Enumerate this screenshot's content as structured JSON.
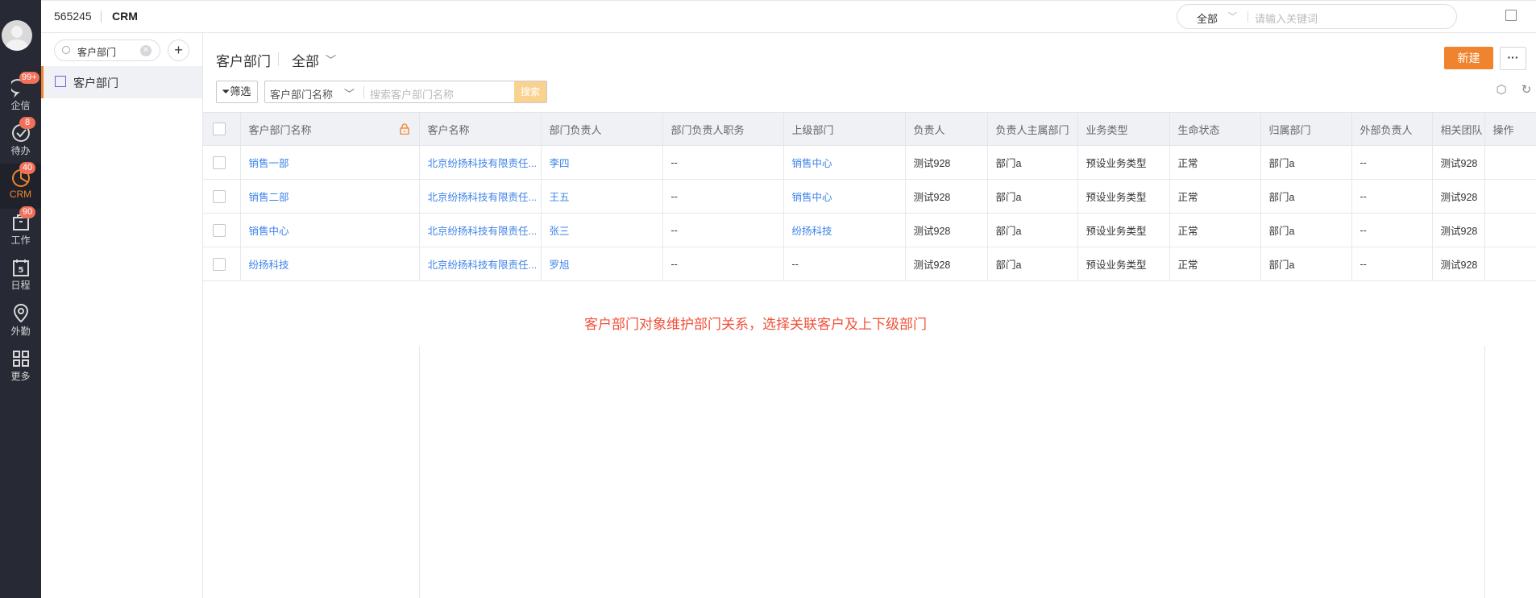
{
  "nav": {
    "items": [
      {
        "label": "企信",
        "badge": "99+",
        "icon": "chat-bubble-icon"
      },
      {
        "label": "待办",
        "badge": "8",
        "icon": "check-circle-icon"
      },
      {
        "label": "CRM",
        "badge": "40",
        "icon": "pie-chart-icon",
        "active": true
      },
      {
        "label": "工作",
        "badge": "90",
        "icon": "briefcase-icon"
      },
      {
        "label": "日程",
        "badge": null,
        "icon": "calendar-icon",
        "icon_text": "5"
      },
      {
        "label": "外勤",
        "badge": null,
        "icon": "location-pin-icon"
      },
      {
        "label": "更多",
        "badge": null,
        "icon": "grid-icon"
      }
    ]
  },
  "topbar": {
    "tenant_id": "565245",
    "app_name": "CRM",
    "search_scope": "全部",
    "search_placeholder": "请输入关键词"
  },
  "sidebar": {
    "search_value": "客户部门",
    "items": [
      {
        "label": "客户部门"
      }
    ]
  },
  "main": {
    "title": "客户部门",
    "scope": "全部",
    "new_label": "新建",
    "more_label": "···",
    "filter_label": "筛选",
    "search_field": "客户部门名称",
    "search_placeholder": "搜索客户部门名称",
    "search_button": "搜索"
  },
  "table": {
    "columns": [
      "客户部门名称",
      "客户名称",
      "部门负责人",
      "部门负责人职务",
      "上级部门",
      "负责人",
      "负责人主属部门",
      "业务类型",
      "生命状态",
      "归属部门",
      "外部负责人",
      "相关团队",
      "操作"
    ],
    "rows": [
      [
        "销售一部",
        "北京纷扬科技有限责任...",
        "李四",
        "--",
        "销售中心",
        "测试928",
        "部门a",
        "预设业务类型",
        "正常",
        "部门a",
        "--",
        "测试928",
        ""
      ],
      [
        "销售二部",
        "北京纷扬科技有限责任...",
        "王五",
        "--",
        "销售中心",
        "测试928",
        "部门a",
        "预设业务类型",
        "正常",
        "部门a",
        "--",
        "测试928",
        ""
      ],
      [
        "销售中心",
        "北京纷扬科技有限责任...",
        "张三",
        "--",
        "纷扬科技",
        "测试928",
        "部门a",
        "预设业务类型",
        "正常",
        "部门a",
        "--",
        "测试928",
        ""
      ],
      [
        "纷扬科技",
        "北京纷扬科技有限责任...",
        "罗旭",
        "--",
        "--",
        "测试928",
        "部门a",
        "预设业务类型",
        "正常",
        "部门a",
        "--",
        "测试928",
        ""
      ]
    ]
  },
  "annotation": "客户部门对象维护部门关系，选择关联客户及上下级部门",
  "colors": {
    "accent": "#f0832e",
    "link": "#3d83e8",
    "annotation": "#f0503a",
    "nav_bg": "#272a34"
  }
}
